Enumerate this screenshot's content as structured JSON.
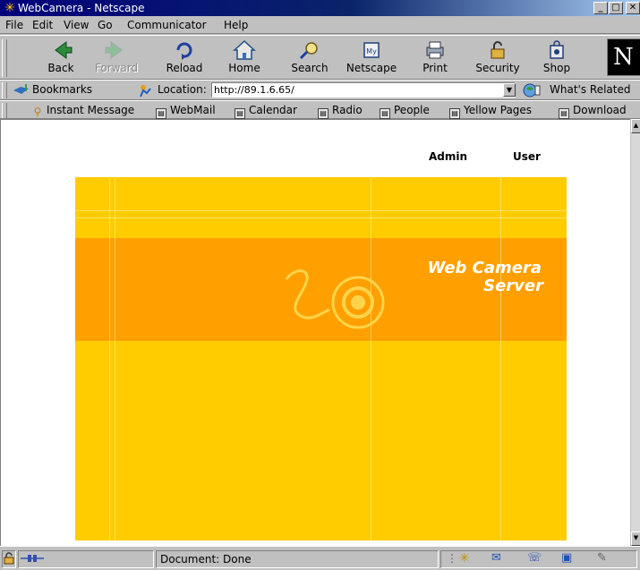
{
  "window": {
    "title": "WebCamera - Netscape",
    "controls": {
      "minimize": "_",
      "maximize": "□",
      "close": "✕"
    }
  },
  "menu": [
    "File",
    "Edit",
    "View",
    "Go",
    "Communicator",
    "Help"
  ],
  "nav_toolbar": {
    "back": "Back",
    "forward": "Forward",
    "reload": "Reload",
    "home": "Home",
    "search": "Search",
    "netscape": "Netscape",
    "print": "Print",
    "security": "Security",
    "shop": "Shop",
    "logo": "N"
  },
  "location_bar": {
    "bookmarks": "Bookmarks",
    "location_label": "Location:",
    "url": "http://89.1.6.65/",
    "whats_related": "What's Related"
  },
  "personal_toolbar": [
    "Instant Message",
    "WebMail",
    "Calendar",
    "Radio",
    "People",
    "Yellow Pages",
    "Download"
  ],
  "page": {
    "admin_link": "Admin",
    "user_link": "User",
    "banner_line1": "Web Camera",
    "banner_line2": "Server"
  },
  "status": {
    "message": "Document: Done"
  },
  "colors": {
    "banner_yellow": "#ffcc00",
    "banner_orange": "#ffa000",
    "titlebar": "#00007b"
  }
}
